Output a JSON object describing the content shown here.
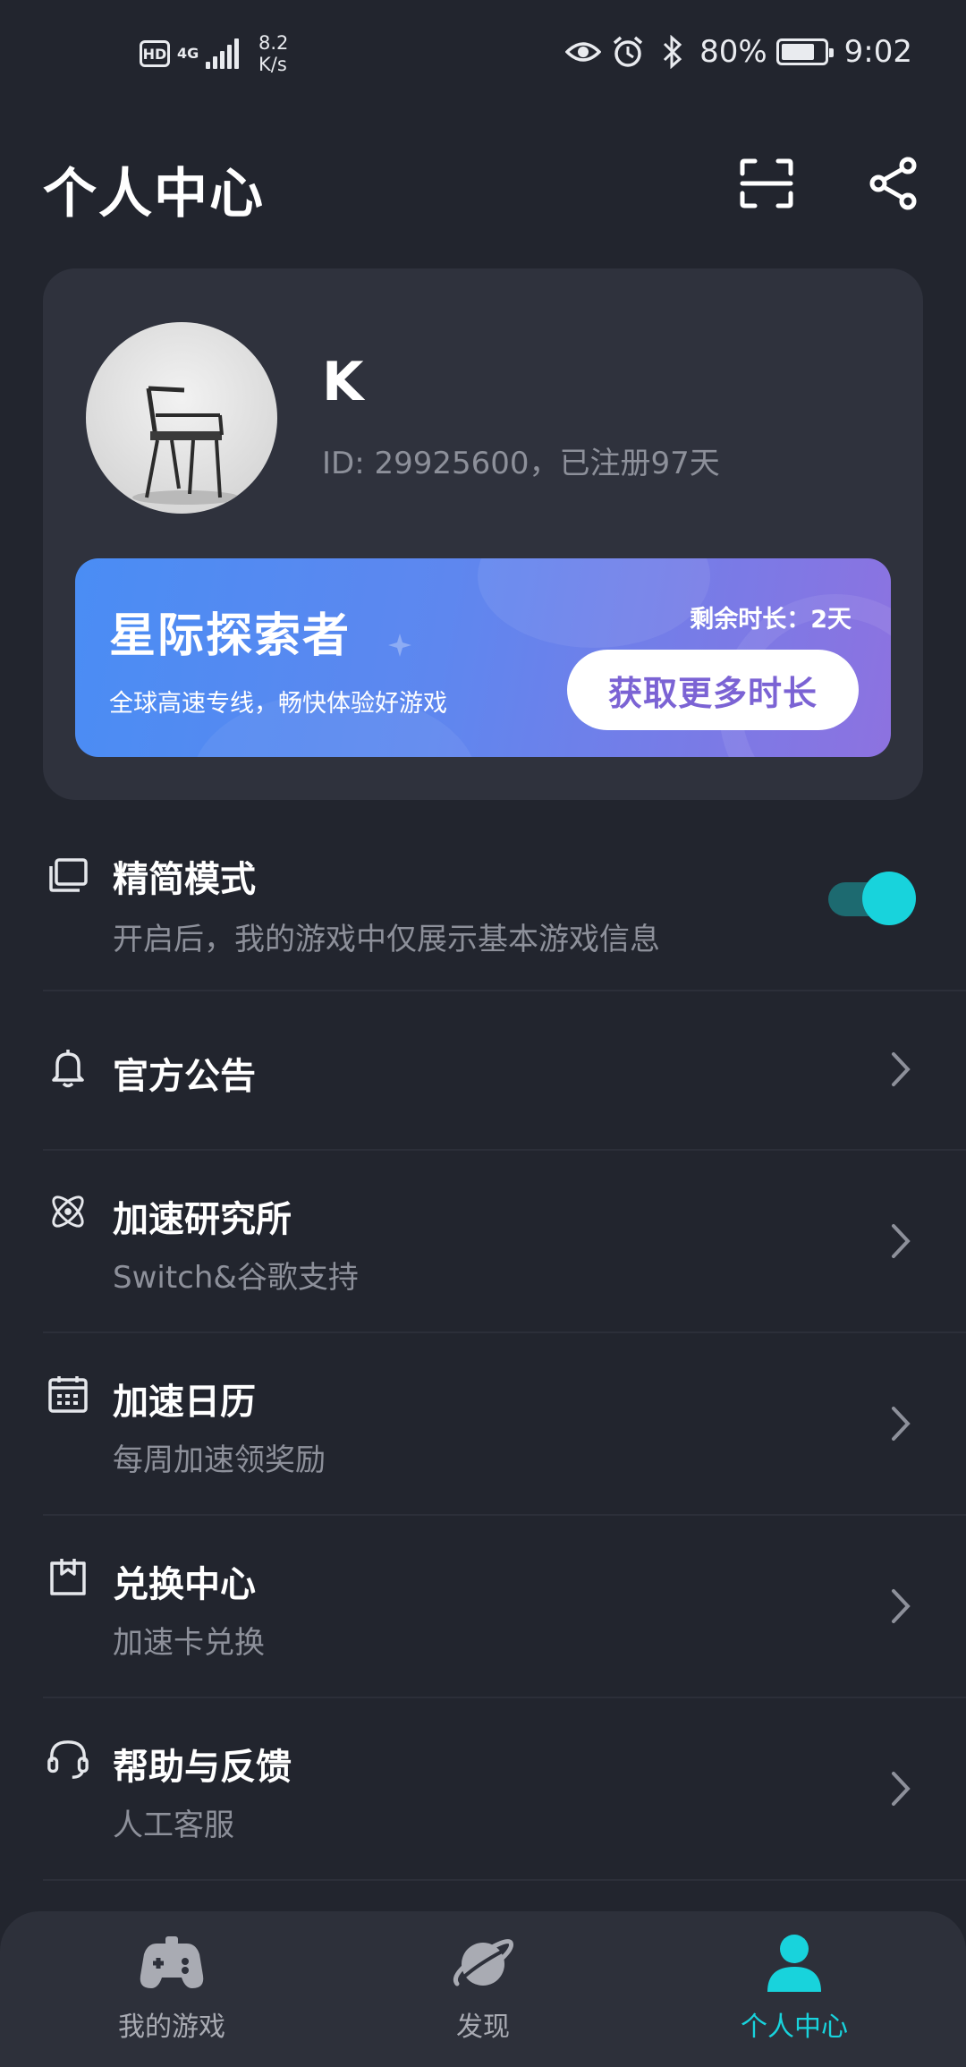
{
  "status_bar": {
    "hd": "HD",
    "network": "4G",
    "speed_value": "8.2",
    "speed_unit": "K/s",
    "battery": "80%",
    "battery_level": 0.8,
    "time": "9:02",
    "icons": [
      "eye-icon",
      "alarm-icon",
      "bluetooth-icon"
    ]
  },
  "header": {
    "title": "个人中心",
    "scan_icon": "scan-icon",
    "share_icon": "share-icon"
  },
  "profile": {
    "username": "K",
    "id_text": "ID: 29925600，已注册97天",
    "avatar": "chair-photo"
  },
  "vip": {
    "title": "星际探索者",
    "subtitle": "全球高速专线，畅快体验好游戏",
    "remaining_label": "剩余时长：",
    "remaining_value": "2天",
    "button": "获取更多时长"
  },
  "settings": {
    "simple_mode": {
      "title": "精简模式",
      "subtitle": "开启后，我的游戏中仅展示基本游戏信息",
      "enabled": true,
      "icon": "layers-icon"
    },
    "items": [
      {
        "title": "官方公告",
        "subtitle": "",
        "icon": "bell-icon"
      },
      {
        "title": "加速研究所",
        "subtitle": "Switch&谷歌支持",
        "icon": "atom-icon"
      },
      {
        "title": "加速日历",
        "subtitle": "每周加速领奖励",
        "icon": "calendar-icon"
      },
      {
        "title": "兑换中心",
        "subtitle": "加速卡兑换",
        "icon": "gift-box-icon"
      },
      {
        "title": "帮助与反馈",
        "subtitle": "人工客服",
        "icon": "headset-icon"
      }
    ]
  },
  "bottom_nav": {
    "items": [
      {
        "label": "我的游戏",
        "icon": "gamepad-icon",
        "active": false
      },
      {
        "label": "发现",
        "icon": "planet-icon",
        "active": false
      },
      {
        "label": "个人中心",
        "icon": "person-icon",
        "active": true
      }
    ]
  },
  "colors": {
    "background": "#22252e",
    "card": "#2f323d",
    "accent": "#18d3dc",
    "muted_text": "#8d909a",
    "vip_button_text": "#7b63d4"
  }
}
